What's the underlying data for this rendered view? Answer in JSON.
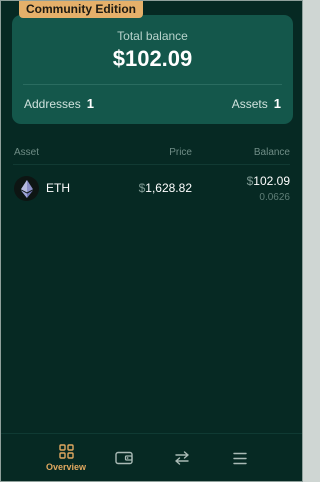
{
  "badge": {
    "label": "Community Edition"
  },
  "balance_card": {
    "label": "Total balance",
    "value": "$102.09",
    "addresses_label": "Addresses",
    "addresses_count": "1",
    "assets_label": "Assets",
    "assets_count": "1"
  },
  "table": {
    "headers": {
      "asset": "Asset",
      "price": "Price",
      "balance": "Balance"
    },
    "rows": [
      {
        "icon": "ethereum-icon",
        "asset": "ETH",
        "price_currency": "$",
        "price": "1,628.82",
        "balance_currency": "$",
        "balance": "102.09",
        "amount": "0.0626"
      }
    ]
  },
  "nav": {
    "items": [
      {
        "label": "Overview",
        "icon": "grid-icon",
        "active": true
      },
      {
        "label": "",
        "icon": "wallet-icon"
      },
      {
        "label": "",
        "icon": "swap-icon"
      },
      {
        "label": "",
        "icon": "menu-icon"
      }
    ],
    "active_color": "#e0a860"
  },
  "colors": {
    "background": "#062923",
    "card": "#14574b",
    "accent": "#e5b06a"
  }
}
